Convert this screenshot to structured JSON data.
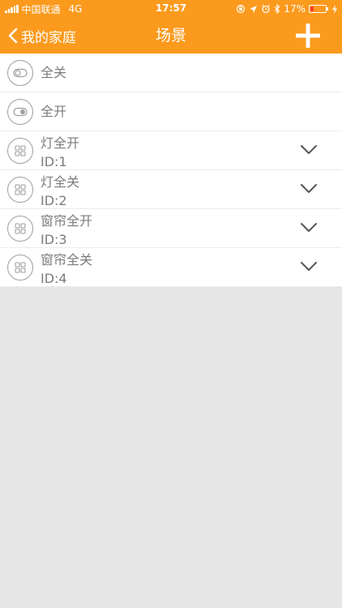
{
  "status_bar": {
    "carrier": "中国联通",
    "network": "4G",
    "time": "17:57",
    "battery": "17%"
  },
  "nav": {
    "back_label": "我的家庭",
    "title": "场景"
  },
  "scenes": {
    "toggles": [
      {
        "label": "全关",
        "state": "off"
      },
      {
        "label": "全开",
        "state": "on"
      }
    ],
    "items": [
      {
        "name": "灯全开",
        "id": "ID:1"
      },
      {
        "name": "灯全关",
        "id": "ID:2"
      },
      {
        "name": "窗帘全开",
        "id": "ID:3"
      },
      {
        "name": "窗帘全关",
        "id": "ID:4"
      }
    ]
  },
  "colors": {
    "accent": "#fb9a1d",
    "background": "#e6e6e6",
    "text": "#7b7b7b"
  }
}
